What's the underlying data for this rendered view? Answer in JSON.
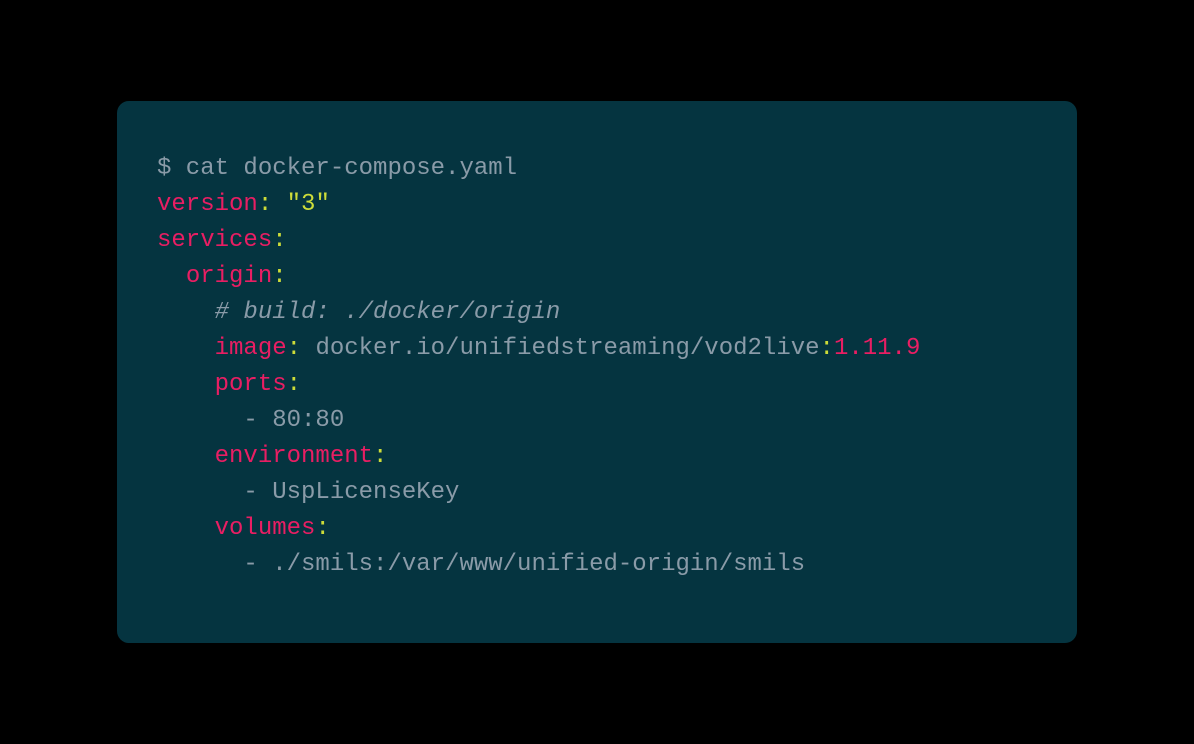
{
  "terminal": {
    "prompt": "$ cat docker-compose.yaml",
    "yaml": {
      "version_key": "version",
      "version_value": "\"3\"",
      "services_key": "services",
      "origin_key": "origin",
      "comment": "# build: ./docker/origin",
      "image_key": "image",
      "image_value": "docker.io/unifiedstreaming/vod2live",
      "image_tag": "1.11.9",
      "ports_key": "ports",
      "ports_value": "80:80",
      "environment_key": "environment",
      "environment_value": "UspLicenseKey",
      "volumes_key": "volumes",
      "volumes_value": "./smils:/var/www/unified-origin/smils"
    }
  }
}
